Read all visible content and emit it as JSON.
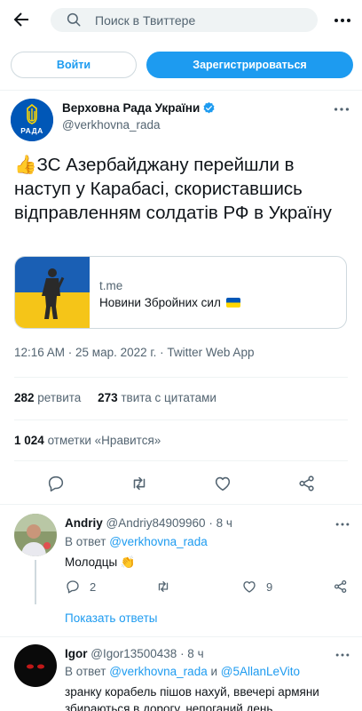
{
  "search": {
    "placeholder": "Поиск в Твиттере"
  },
  "auth": {
    "login_label": "Войти",
    "signup_label": "Зарегистрироваться"
  },
  "tweet": {
    "author_name": "Верховна Рада України",
    "author_handle": "@verkhovna_rada",
    "avatar_text": "РАДА",
    "emoji": "👍",
    "text": "ЗС Азербайджану перейшли в наступ у Карабасі, скориставшись відправленням солдатів РФ в Україну",
    "card": {
      "domain": "t.me",
      "title": "Новини Збройних сил"
    },
    "meta": "12:16 AM · 25 мар. 2022 г. · Twitter Web App",
    "retweets_count": "282",
    "retweets_label": "ретвита",
    "quotes_count": "273",
    "quotes_label": "твита с цитатами",
    "likes_count": "1 024",
    "likes_label": "отметки «Нравится»"
  },
  "replies": [
    {
      "name": "Andriy",
      "handle": "@Andriy84909960",
      "time": "· 8 ч",
      "in_reply_prefix": "В ответ",
      "in_reply_users": [
        "@verkhovna_rada"
      ],
      "text": "Молодцы 👏",
      "reply_count": "2",
      "like_count": "9",
      "show_replies_label": "Показать ответы"
    },
    {
      "name": "Igor",
      "handle": "@Igor13500438",
      "time": "· 8 ч",
      "in_reply_prefix": "В ответ",
      "in_reply_users": [
        "@verkhovna_rada",
        "@5AllanLeVito"
      ],
      "in_reply_joiner": "и",
      "text": "зранку корабель пішов нахуй, ввечері армяни збираються в дорогу, непоганий день"
    }
  ],
  "colors": {
    "accent": "#1d9bf0",
    "text": "#0f1419",
    "secondary": "#536471",
    "border": "#cfd9de"
  },
  "icons": {
    "back": "back-arrow-icon",
    "search": "search-icon",
    "more": "more-horizontal-icon",
    "verified": "verified-badge-icon",
    "reply": "reply-icon",
    "retweet": "retweet-icon",
    "like": "like-icon",
    "share": "share-icon"
  }
}
